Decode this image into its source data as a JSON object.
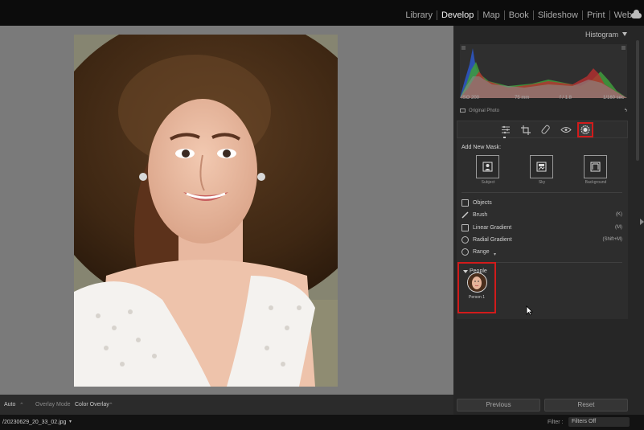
{
  "modules": [
    "Library",
    "Develop",
    "Map",
    "Book",
    "Slideshow",
    "Print",
    "Web"
  ],
  "active_module": "Develop",
  "panel": {
    "histogram_title": "Histogram",
    "exif": {
      "iso": "ISO 200",
      "focal": "75 mm",
      "aperture": "f / 1.8",
      "shutter": "1/160 sec"
    },
    "original_photo": "Original Photo"
  },
  "masking": {
    "add_new_mask": "Add New Mask:",
    "quick_masks": [
      "Subject",
      "Sky",
      "Background"
    ],
    "rows": [
      {
        "label": "Objects",
        "key": ""
      },
      {
        "label": "Brush",
        "key": "(K)"
      },
      {
        "label": "Linear Gradient",
        "key": "(M)"
      },
      {
        "label": "Radial Gradient",
        "key": "(Shift+M)"
      },
      {
        "label": "Range",
        "key": ""
      }
    ],
    "people_header": "People",
    "person_label": "Person 1"
  },
  "buttons": {
    "previous": "Previous",
    "reset": "Reset"
  },
  "toolbar": {
    "auto": "Auto",
    "overlay_mode_label": "Overlay Mode",
    "overlay_mode_value": "Color Overlay"
  },
  "filmstrip": {
    "filename": "/20230629_20_33_02.jpg",
    "filter_label": "Filter :",
    "filter_value": "Filters Off"
  },
  "colors": {
    "highlight": "#d21b1b",
    "panel_bg": "#262626",
    "canvas_bg": "#7a7a7a"
  }
}
